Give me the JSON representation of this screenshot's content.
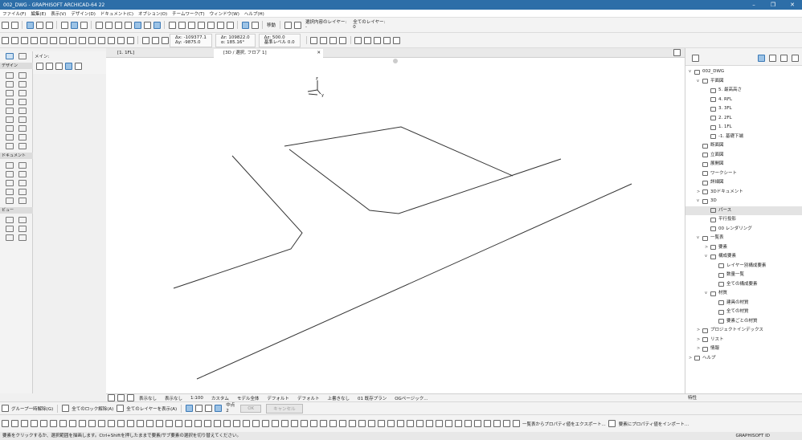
{
  "window": {
    "title": "002_DWG - GRAPHISOFT ARCHICAD-64 22"
  },
  "menu": [
    "ファイル(F)",
    "編集(E)",
    "表示(V)",
    "デザイン(D)",
    "ドキュメント(C)",
    "オプション(O)",
    "チームワーク(T)",
    "ウィンドウ(W)",
    "ヘルプ(H)"
  ],
  "toolbar1": {
    "move_label": "移動",
    "layer_label1": "選択内容のレイヤー:",
    "layer_label2": "全てのレイヤー:",
    "layer_val1": "-",
    "layer_val2": "0"
  },
  "toolbar2": {
    "dx": "Δx: -109377.1",
    "dy": "Δy: -9875.0",
    "dr": "Δr: 109822.0",
    "da": "α: 185.16°",
    "dz": "Δz: 500.0",
    "ref": "基準レベル 0.0"
  },
  "left": {
    "section_main": "メイン:",
    "design": "デザイン",
    "document": "ドキュメント",
    "view": "ビュー"
  },
  "tabs": [
    {
      "label": "[1. 1FL]"
    },
    {
      "label": "[3D / 選択, フロア 1]"
    }
  ],
  "bottom1": [
    "表示なし",
    "表示なし",
    "1:100",
    "カスタム",
    "モデル全体",
    "デフォルト",
    "デフォルト",
    "上書きなし",
    "01 既存プラン",
    "OGページック..."
  ],
  "bottom2": {
    "group": "グループ一時解除(G)",
    "lock": "全てのロック解除(A)",
    "showlayers": "全てのレイヤーを表示(A)",
    "mode": "中点",
    "mode_val": "2",
    "ok": "OK",
    "cancel": "キャンセル"
  },
  "bottom3": {
    "export": "一覧表からプロパティ値をエクスポート...",
    "import": "要素にプロパティ値をインポート..."
  },
  "status": {
    "message": "要素をクリックするか、選択範囲を描画します。Ctrl+Shiftを押したままで要素/サブ要素の選択を切り替えてください。",
    "graphisoft": "GRAPHISOFT ID"
  },
  "navigator": {
    "items": [
      {
        "label": "002_DWG",
        "depth": 0,
        "arrow": "v"
      },
      {
        "label": "平面図",
        "depth": 1,
        "arrow": "v"
      },
      {
        "label": "5. 最高高さ",
        "depth": 2,
        "arrow": ""
      },
      {
        "label": "4. RFL",
        "depth": 2,
        "arrow": ""
      },
      {
        "label": "3. 3FL",
        "depth": 2,
        "arrow": ""
      },
      {
        "label": "2. 2FL",
        "depth": 2,
        "arrow": ""
      },
      {
        "label": "1. 1FL",
        "depth": 2,
        "arrow": ""
      },
      {
        "label": "-1. 基礎下端",
        "depth": 2,
        "arrow": ""
      },
      {
        "label": "断面図",
        "depth": 1,
        "arrow": ""
      },
      {
        "label": "立面図",
        "depth": 1,
        "arrow": ""
      },
      {
        "label": "展開図",
        "depth": 1,
        "arrow": ""
      },
      {
        "label": "ワークシート",
        "depth": 1,
        "arrow": ""
      },
      {
        "label": "詳細図",
        "depth": 1,
        "arrow": ""
      },
      {
        "label": "3Dドキュメント",
        "depth": 1,
        "arrow": ">"
      },
      {
        "label": "3D",
        "depth": 1,
        "arrow": "v"
      },
      {
        "label": "パース",
        "depth": 2,
        "arrow": "",
        "selected": true
      },
      {
        "label": "平行投影",
        "depth": 2,
        "arrow": ""
      },
      {
        "label": "00 レンダリング",
        "depth": 2,
        "arrow": ""
      },
      {
        "label": "一覧表",
        "depth": 1,
        "arrow": "v"
      },
      {
        "label": "要素",
        "depth": 2,
        "arrow": ">"
      },
      {
        "label": "構成要素",
        "depth": 2,
        "arrow": "v"
      },
      {
        "label": "レイヤー別構成要素",
        "depth": 3,
        "arrow": ""
      },
      {
        "label": "数量一覧",
        "depth": 3,
        "arrow": ""
      },
      {
        "label": "全ての構成要素",
        "depth": 3,
        "arrow": ""
      },
      {
        "label": "材質",
        "depth": 2,
        "arrow": "v"
      },
      {
        "label": "建具の材質",
        "depth": 3,
        "arrow": ""
      },
      {
        "label": "全ての材質",
        "depth": 3,
        "arrow": ""
      },
      {
        "label": "要素ごとの材質",
        "depth": 3,
        "arrow": ""
      },
      {
        "label": "プロジェクトインデックス",
        "depth": 1,
        "arrow": ">"
      },
      {
        "label": "リスト",
        "depth": 1,
        "arrow": ">"
      },
      {
        "label": "情報",
        "depth": 1,
        "arrow": ">"
      },
      {
        "label": "ヘルプ",
        "depth": 0,
        "arrow": ">"
      }
    ],
    "props_label": "特性"
  },
  "axis": {
    "z": "z",
    "y": "y"
  },
  "colors": {
    "titlebar": "#2d6ea8",
    "accent": "#9cc3e6"
  }
}
